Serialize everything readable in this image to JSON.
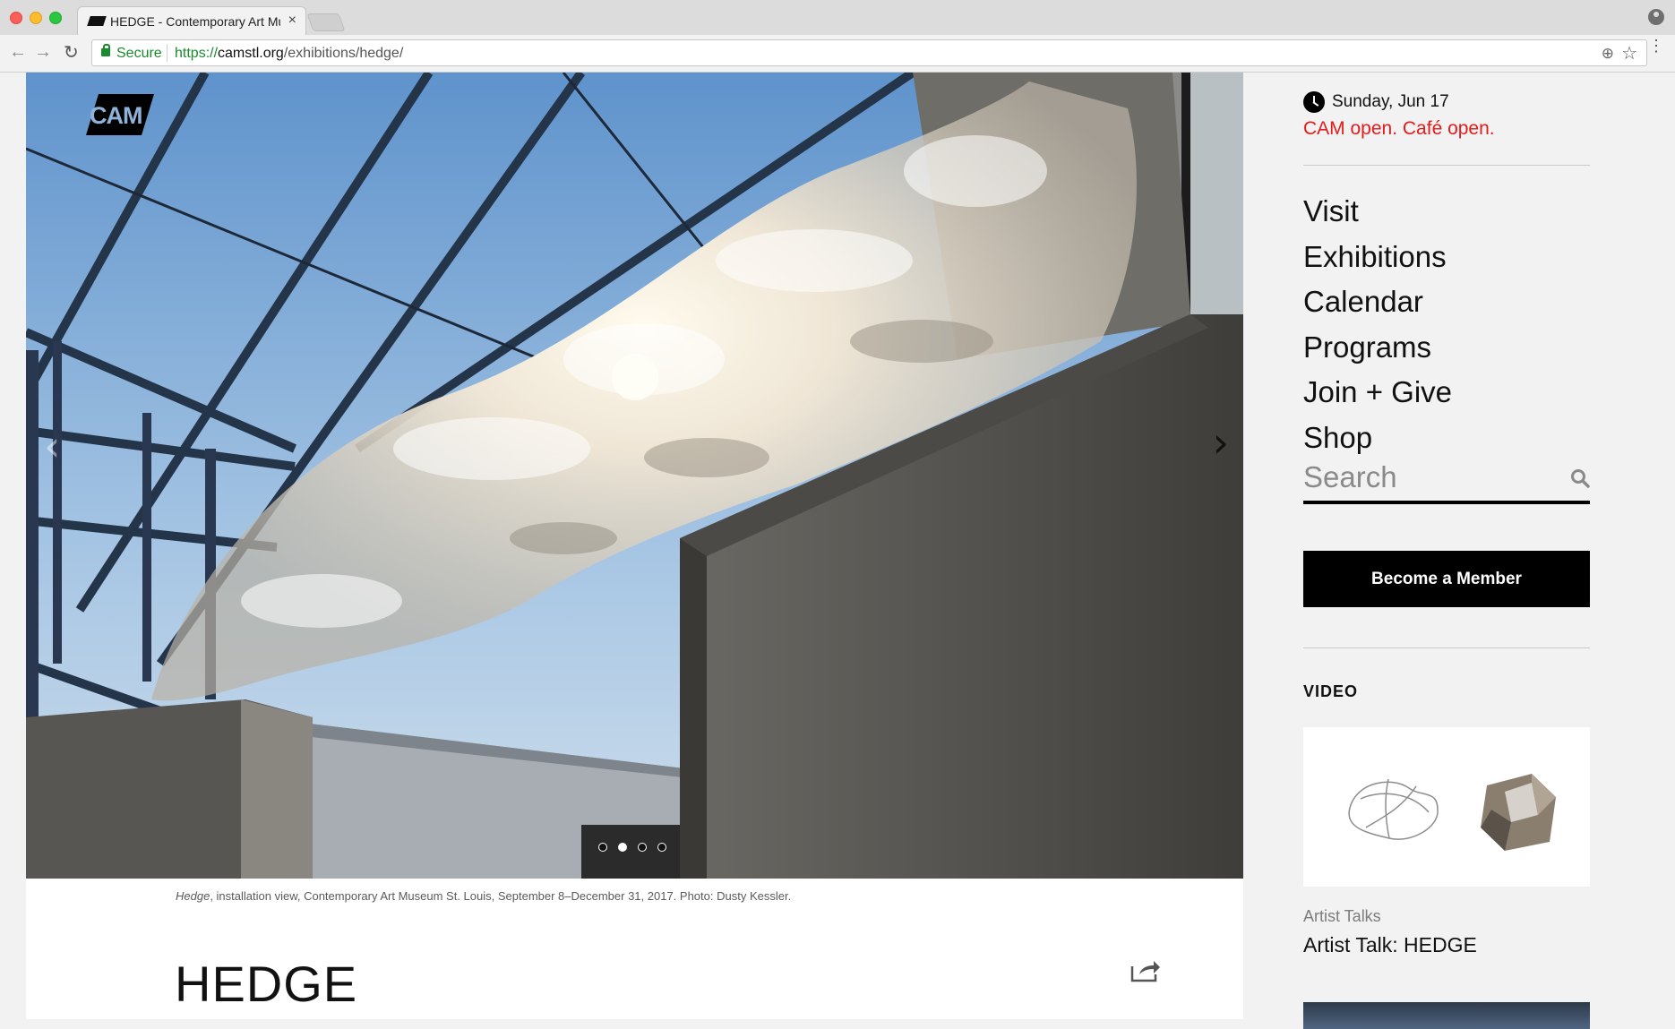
{
  "browser": {
    "tab_title": "HEDGE - Contemporary Art Mu",
    "tab_close": "×",
    "secure_label": "Secure",
    "url_scheme": "https://",
    "url_host": "camstl.org",
    "url_path": "/exhibitions/hedge/"
  },
  "logo": {
    "text": "CAM"
  },
  "hero": {
    "prev_arrow": "‹",
    "next_arrow": "›",
    "slide_count": 4,
    "active_slide": 2
  },
  "caption": {
    "title": "Hedge",
    "text": ", installation view, Contemporary Art Museum St. Louis, September 8–December 31, 2017. Photo: Dusty Kessler."
  },
  "page_title": "HEDGE",
  "sidebar": {
    "date": "Sunday, Jun 17",
    "status": "CAM open. Café open.",
    "status_color": "#e21b1b",
    "nav": [
      "Visit",
      "Exhibitions",
      "Calendar",
      "Programs",
      "Join + Give",
      "Shop"
    ],
    "search_placeholder": "Search",
    "member_button": "Become a Member",
    "video_heading": "VIDEO",
    "video_category": "Artist Talks",
    "video_title": "Artist Talk: HEDGE"
  }
}
